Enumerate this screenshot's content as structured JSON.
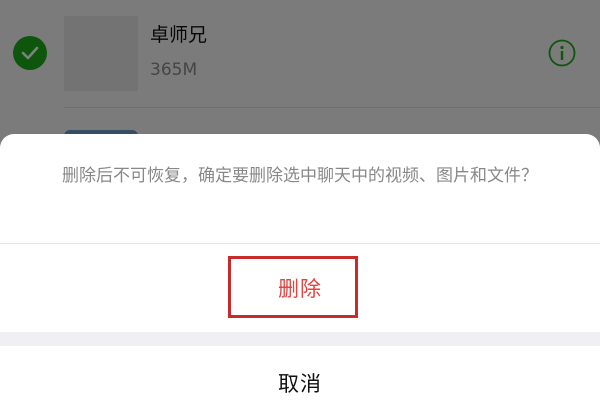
{
  "file_list": {
    "items": [
      {
        "selected": true,
        "title": "卓师兄",
        "size": "365M",
        "info_icon": "info-icon"
      }
    ]
  },
  "action_sheet": {
    "message": "删除后不可恢复，确定要删除选中聊天中的视频、图片和文件？",
    "delete_label": "删除",
    "cancel_label": "取消"
  },
  "colors": {
    "accent_green": "#1aad19",
    "destructive_red": "#e64340",
    "highlight_red": "#c92a2a"
  }
}
